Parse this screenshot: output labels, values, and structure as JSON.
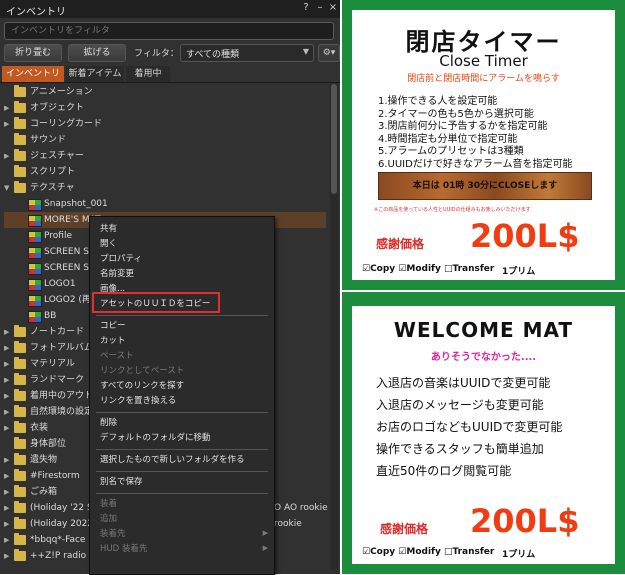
{
  "inventory": {
    "title": "インベントリ",
    "title_icons": {
      "help": "?",
      "minimize": "–",
      "close": "×"
    },
    "search_placeholder": "インベントリをフィルタ",
    "toolbar": {
      "collapse": "折り畳む",
      "expand": "拡げる",
      "filter_label": "フィルタ：",
      "filter_value": "すべての種類",
      "gear": "⚙▾"
    },
    "tabs": [
      "インベントリ",
      "新着アイテム",
      "着用中"
    ],
    "tree": [
      {
        "label": "アニメーション",
        "icon": "animation-icon",
        "arrow": ""
      },
      {
        "label": "オブジェクト",
        "icon": "folder-icon",
        "arrow": "▶"
      },
      {
        "label": "コーリングカード",
        "icon": "folder-icon",
        "arrow": "▶"
      },
      {
        "label": "サウンド",
        "icon": "folder-icon",
        "arrow": ""
      },
      {
        "label": "ジェスチャー",
        "icon": "folder-icon",
        "arrow": "▶"
      },
      {
        "label": "スクリプト",
        "icon": "folder-icon",
        "arrow": ""
      },
      {
        "label": "テクスチャ",
        "icon": "folder-icon",
        "arrow": "▼"
      },
      {
        "label": "Snapshot_001",
        "icon": "texture-icon",
        "arrow": "",
        "indent": 1
      },
      {
        "label": "MORE'S MAT",
        "icon": "texture-icon",
        "arrow": "",
        "indent": 1,
        "selected": true
      },
      {
        "label": "Profile",
        "icon": "texture-icon",
        "arrow": "",
        "indent": 1
      },
      {
        "label": "SCREEN SH",
        "icon": "texture-icon",
        "arrow": "",
        "indent": 1
      },
      {
        "label": "SCREEN SH",
        "icon": "texture-icon",
        "arrow": "",
        "indent": 1
      },
      {
        "label": "LOGO1",
        "icon": "texture-icon",
        "arrow": "",
        "indent": 1
      },
      {
        "label": "LOGO2 (再",
        "icon": "texture-icon",
        "arrow": "",
        "indent": 1
      },
      {
        "label": "BB",
        "icon": "texture-icon",
        "arrow": "",
        "indent": 1
      },
      {
        "label": "ノートカード",
        "icon": "folder-icon",
        "arrow": "▶"
      },
      {
        "label": "フォトアルバム",
        "icon": "folder-icon",
        "arrow": "▶"
      },
      {
        "label": "マテリアル",
        "icon": "folder-icon",
        "arrow": "▶"
      },
      {
        "label": "ランドマーク",
        "icon": "folder-icon",
        "arrow": "▶"
      },
      {
        "label": "着用中のアウト",
        "icon": "folder-icon",
        "arrow": "▶"
      },
      {
        "label": "自然環境の設定",
        "icon": "folder-icon",
        "arrow": "▶"
      },
      {
        "label": "衣装",
        "icon": "folder-icon",
        "arrow": "▶"
      },
      {
        "label": "身体部位",
        "icon": "folder-icon",
        "arrow": ""
      },
      {
        "label": "遺失物",
        "icon": "folder-icon",
        "arrow": "▶"
      },
      {
        "label": "#Firestorm",
        "icon": "folder-icon",
        "arrow": "▶"
      },
      {
        "label": "ごみ箱",
        "icon": "trash-icon",
        "arrow": "▶"
      },
      {
        "label": "(Holiday '22 S",
        "icon": "folder-icon",
        "arrow": "▶",
        "suffix": "O AO rookie"
      },
      {
        "label": "(Holiday 2022",
        "icon": "folder-icon",
        "arrow": "▶",
        "suffix": "rookie"
      },
      {
        "label": "*bbqq*-Face",
        "icon": "folder-icon",
        "arrow": "▶"
      },
      {
        "label": "++Z!P radio",
        "icon": "folder-icon",
        "arrow": "▶"
      }
    ],
    "context_menu": {
      "items": [
        {
          "label": "共有",
          "enabled": true
        },
        {
          "label": "開く",
          "enabled": true
        },
        {
          "label": "プロパティ",
          "enabled": true
        },
        {
          "label": "名前変更",
          "enabled": true
        },
        {
          "label": "画像...",
          "enabled": true
        },
        {
          "label": "アセットのＵＵＩＤをコピー",
          "enabled": true,
          "highlighted": true
        },
        {
          "sep": true
        },
        {
          "label": "コピー",
          "enabled": true
        },
        {
          "label": "カット",
          "enabled": true
        },
        {
          "label": "ペースト",
          "enabled": false
        },
        {
          "label": "リンクとしてペースト",
          "enabled": false
        },
        {
          "label": "すべてのリンクを探す",
          "enabled": true
        },
        {
          "label": "リンクを置き換える",
          "enabled": true
        },
        {
          "sep": true
        },
        {
          "label": "削除",
          "enabled": true
        },
        {
          "label": "デフォルトのフォルダに移動",
          "enabled": true
        },
        {
          "sep": true
        },
        {
          "label": "選択したもので新しいフォルダを作る",
          "enabled": true
        },
        {
          "sep": true
        },
        {
          "label": "別名で保存",
          "enabled": true
        },
        {
          "sep": true
        },
        {
          "label": "装着",
          "enabled": false
        },
        {
          "label": "追加",
          "enabled": false
        },
        {
          "label": "装着先",
          "enabled": false,
          "submenu": true
        },
        {
          "label": "HUD 装着先",
          "enabled": false,
          "submenu": true
        }
      ]
    }
  },
  "panel_timer": {
    "title": "閉店タイマー",
    "subtitle": "Close Timer",
    "tagline": "閉店前と閉店時間にアラームを鳴らす",
    "features": [
      "1.操作できる人を設定可能",
      "2.タイマーの色も5色から選択可能",
      "3.閉店前何分に予告するかを指定可能",
      "4.時間指定も分単位で指定可能",
      "5.アラームのプリセットは3種類",
      "6.UUIDだけで好きなアラーム音を指定可能"
    ],
    "wood_sign": "本日は 01時 30分にCLOSEします",
    "note": "※この商品を使っている人性とUUIDの仕組みもお楽しみいただけます",
    "price_label": "感謝価格",
    "price": "200L$",
    "permissions": "☑Copy ☑Modify □Transfer",
    "prim": "1プリム"
  },
  "panel_mat": {
    "title": "WELCOME MAT",
    "tagline": "ありそうでなかった....",
    "features": [
      "入退店の音楽はUUIDで変更可能",
      "入退店のメッセージも変更可能",
      "お店のロゴなどもUUIDで変更可能",
      "操作できるスタッフも簡単追加",
      "直近50件のログ閲覧可能"
    ],
    "price_label": "感謝価格",
    "price": "200L$",
    "permissions": "☑Copy ☑Modify □Transfer",
    "prim": "1プリム"
  },
  "colors": {
    "panel_green": "#1c8d3c",
    "price_red": "#f03c10",
    "tab_active": "#c15922",
    "highlight_box": "#e03030"
  }
}
